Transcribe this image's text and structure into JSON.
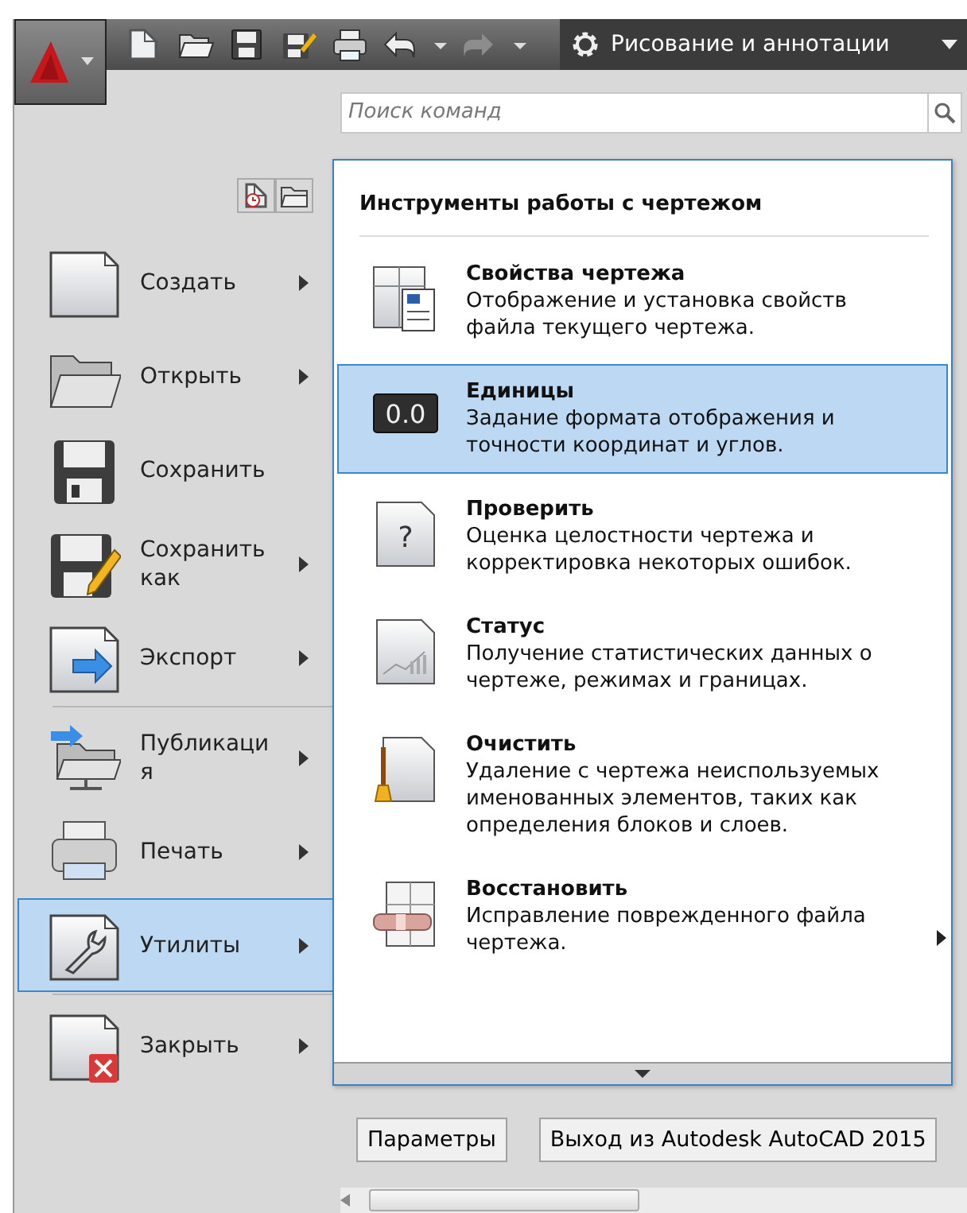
{
  "toolbar": {
    "workspace": "Рисование и аннотации"
  },
  "search": {
    "placeholder": "Поиск команд"
  },
  "menu": {
    "groups": [
      [
        {
          "label_lines": [
            "Создать"
          ],
          "has_submenu": true,
          "selected": false
        },
        {
          "label_lines": [
            "Открыть"
          ],
          "has_submenu": true,
          "selected": false
        },
        {
          "label_lines": [
            "Сохранить"
          ],
          "has_submenu": false,
          "selected": false
        },
        {
          "label_lines": [
            "Сохранить",
            "как"
          ],
          "has_submenu": true,
          "selected": false
        },
        {
          "label_lines": [
            "Экспорт"
          ],
          "has_submenu": true,
          "selected": false
        }
      ],
      [
        {
          "label_lines": [
            "Публикаци",
            "я"
          ],
          "has_submenu": true,
          "selected": false
        },
        {
          "label_lines": [
            "Печать"
          ],
          "has_submenu": true,
          "selected": false
        },
        {
          "label_lines": [
            "Утилиты"
          ],
          "has_submenu": true,
          "selected": true
        }
      ],
      [
        {
          "label_lines": [
            "Закрыть"
          ],
          "has_submenu": true,
          "selected": false
        }
      ]
    ]
  },
  "submenu": {
    "title": "Инструменты работы с чертежом",
    "items": [
      {
        "title": "Свойства чертежа",
        "description_lines": [
          "Отображение и установка свойств",
          "файла текущего чертежа."
        ],
        "selected": false,
        "has_submenu": false
      },
      {
        "title": "Единицы",
        "icon_label": "0.0",
        "description_lines": [
          "Задание формата отображения и",
          "точности координат и углов."
        ],
        "selected": true,
        "has_submenu": false
      },
      {
        "title": "Проверить",
        "icon_label": "?",
        "description_lines": [
          "Оценка целостности чертежа и",
          "корректировка некоторых ошибок."
        ],
        "selected": false,
        "has_submenu": false
      },
      {
        "title": "Статус",
        "description_lines": [
          "Получение статистических данных о",
          "чертеже, режимах и границах."
        ],
        "selected": false,
        "has_submenu": false
      },
      {
        "title": "Очистить",
        "description_lines": [
          "Удаление с чертежа неиспользуемых",
          "именованных элементов, таких как",
          "определения блоков и слоев."
        ],
        "selected": false,
        "has_submenu": false
      },
      {
        "title": "Восстановить",
        "description_lines": [
          "Исправление поврежденного файла",
          "чертежа."
        ],
        "selected": false,
        "has_submenu": true
      }
    ]
  },
  "buttons": [
    "Параметры",
    "Выход из Autodesk AutoCAD 2015"
  ]
}
